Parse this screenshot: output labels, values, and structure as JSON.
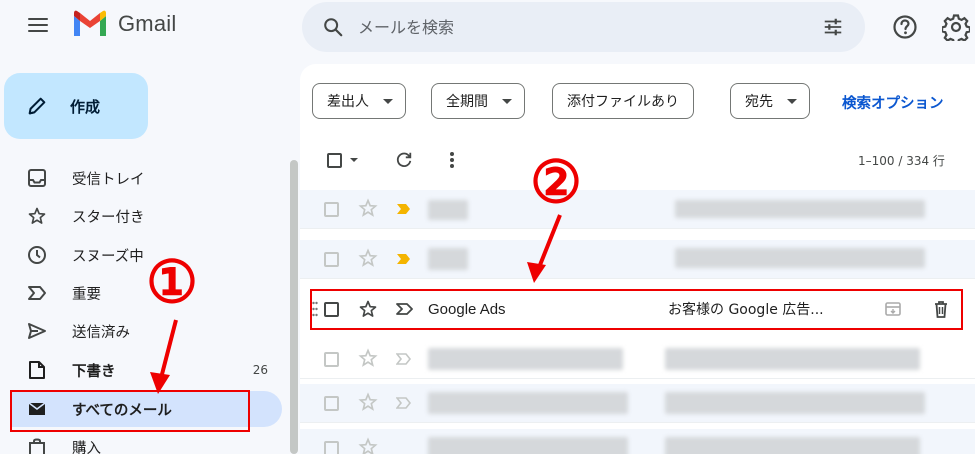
{
  "header": {
    "app_name": "Gmail",
    "search_placeholder": "メールを検索"
  },
  "sidebar": {
    "compose_label": "作成",
    "items": [
      {
        "label": "受信トレイ",
        "icon": "inbox-icon"
      },
      {
        "label": "スター付き",
        "icon": "star-icon"
      },
      {
        "label": "スヌーズ中",
        "icon": "clock-icon"
      },
      {
        "label": "重要",
        "icon": "important-icon"
      },
      {
        "label": "送信済み",
        "icon": "send-icon"
      },
      {
        "label": "下書き",
        "icon": "draft-icon",
        "count": "26"
      },
      {
        "label": "すべてのメール",
        "icon": "all-mail-icon"
      },
      {
        "label": "購入",
        "icon": "shopping-bag-icon"
      }
    ]
  },
  "filters": {
    "sender": "差出人",
    "period": "全期間",
    "attachment": "添付ファイルあり",
    "recipient": "宛先",
    "advanced": "検索オプション"
  },
  "toolbar": {
    "range": "1–100 / 334 行"
  },
  "email": {
    "sender": "Google Ads",
    "subject": "お客様の Google 広告..."
  },
  "annotations": {
    "marker_1": "①",
    "marker_2": "②",
    "color": "#ee0000"
  },
  "colors": {
    "compose_bg": "#c2e7ff",
    "active_nav_bg": "#d3e3fd",
    "link_blue": "#0b57d0",
    "important_marker": "#f4b400"
  }
}
